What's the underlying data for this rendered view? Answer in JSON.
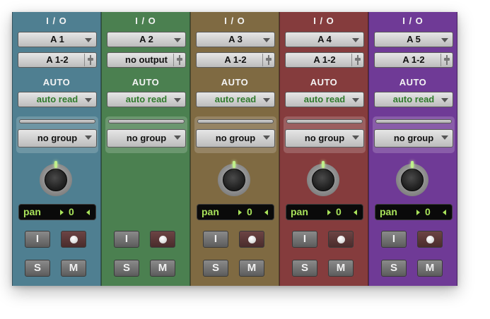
{
  "strips": [
    {
      "io_header": "I / O",
      "input": "A 1",
      "output": "A 1-2",
      "auto_header": "AUTO",
      "automation": "auto read",
      "group": "no group",
      "pan_label": "pan",
      "pan_value": "0",
      "input_button": "I",
      "solo_button": "S",
      "mute_button": "M",
      "color": "#4f7f91"
    },
    {
      "io_header": "I / O",
      "input": "A 2",
      "output": "no output",
      "auto_header": "AUTO",
      "automation": "auto read",
      "group": "no group",
      "pan_label": "",
      "pan_value": "",
      "input_button": "I",
      "solo_button": "S",
      "mute_button": "M",
      "color": "#4b8050"
    },
    {
      "io_header": "I / O",
      "input": "A 3",
      "output": "A 1-2",
      "auto_header": "AUTO",
      "automation": "auto read",
      "group": "no group",
      "pan_label": "pan",
      "pan_value": "0",
      "input_button": "I",
      "solo_button": "S",
      "mute_button": "M",
      "color": "#7f6a42"
    },
    {
      "io_header": "I / O",
      "input": "A 4",
      "output": "A 1-2",
      "auto_header": "AUTO",
      "automation": "auto read",
      "group": "no group",
      "pan_label": "pan",
      "pan_value": "0",
      "input_button": "I",
      "solo_button": "S",
      "mute_button": "M",
      "color": "#853c3d"
    },
    {
      "io_header": "I / O",
      "input": "A 5",
      "output": "A 1-2",
      "auto_header": "AUTO",
      "automation": "auto read",
      "group": "no group",
      "pan_label": "pan",
      "pan_value": "0",
      "input_button": "I",
      "solo_button": "S",
      "mute_button": "M",
      "color": "#6f3a96"
    }
  ],
  "icons": {
    "dropdown": "chevron-down-icon",
    "fader": "fader-icon",
    "record": "record-dot-icon",
    "pan_left": "triangle-left-icon",
    "pan_right": "triangle-right-icon"
  }
}
